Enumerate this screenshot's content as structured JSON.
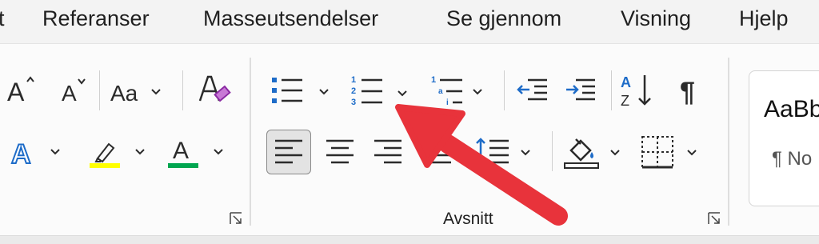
{
  "menu": {
    "items": [
      {
        "label": "t"
      },
      {
        "label": "Referanser"
      },
      {
        "label": "Masseutsendelser"
      },
      {
        "label": "Se gjennom"
      },
      {
        "label": "Visning"
      },
      {
        "label": "Hjelp"
      }
    ]
  },
  "ribbon": {
    "font_group": {
      "grow_font_glyph": "A",
      "shrink_font_glyph": "A",
      "change_case_glyph": "Aa",
      "text_effects_glyph": "A",
      "font_color_glyph": "A",
      "highlight_color": "#ffff00",
      "font_color": "#00a650"
    },
    "paragraph_group": {
      "label": "Avsnitt",
      "pilcrow_glyph": "¶"
    },
    "styles": {
      "sample_text": "AaBb",
      "style_name": "¶ No"
    }
  },
  "annotation": {
    "arrow_color": "#e8333b"
  },
  "colors": {
    "accent_blue": "#1e6cc8",
    "icon_dark": "#2b2b2b"
  }
}
